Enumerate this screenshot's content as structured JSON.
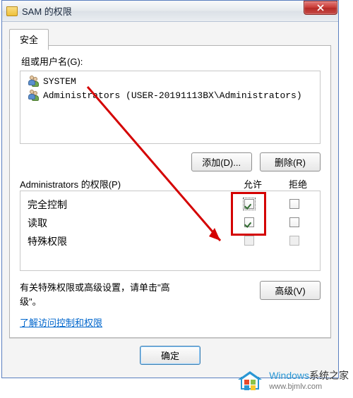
{
  "window": {
    "title": "SAM 的权限"
  },
  "tab": {
    "security": "安全"
  },
  "groups_label": "组或用户名(G):",
  "users": [
    {
      "name": "SYSTEM"
    },
    {
      "name": "Administrators (USER-20191113BX\\Administrators)"
    }
  ],
  "buttons": {
    "add": "添加(D)...",
    "remove": "删除(R)",
    "advanced": "高级(V)",
    "ok": "确定"
  },
  "perm_header": {
    "label": "Administrators 的权限(P)",
    "allow": "允许",
    "deny": "拒绝"
  },
  "permissions": [
    {
      "name": "完全控制",
      "allow": true,
      "deny": false,
      "allow_dotted": true
    },
    {
      "name": "读取",
      "allow": true,
      "deny": false
    },
    {
      "name": "特殊权限",
      "allow": false,
      "deny": false,
      "disabled": true
    }
  ],
  "adv_text_1": "有关特殊权限或高级设置，请单击\"高",
  "adv_text_2": "级\"。",
  "link_text": "了解访问控制和权限",
  "watermark": {
    "line1_a": "Windows",
    "line1_b": "系统之家",
    "line2": "www.bjmlv.com"
  }
}
